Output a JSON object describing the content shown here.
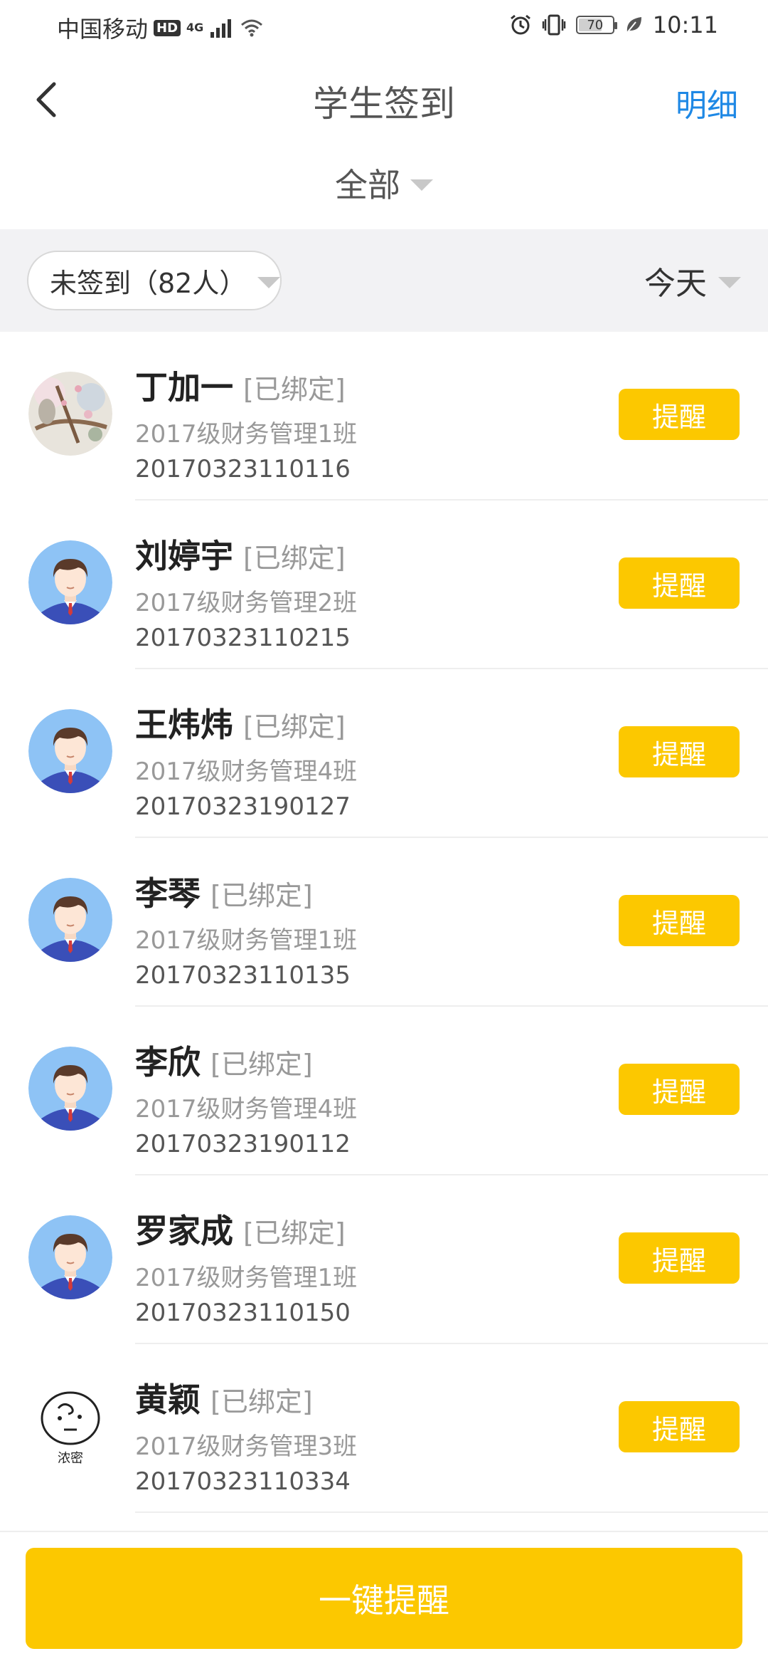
{
  "status_bar": {
    "carrier": "中国移动",
    "hd": "HD",
    "network": "4G",
    "battery": "70",
    "battery_fraction": 0.7,
    "time": "10:11"
  },
  "header": {
    "title": "学生签到",
    "detail": "明细"
  },
  "filter": {
    "scope": "全部",
    "status": "未签到（82人）",
    "date": "今天"
  },
  "students": [
    {
      "name": "丁加一",
      "bound": "[已绑定]",
      "class": "2017级财务管理1班",
      "id": "20170323110116",
      "avatar": "photo-avatar"
    },
    {
      "name": "刘婷宇",
      "bound": "[已绑定]",
      "class": "2017级财务管理2班",
      "id": "20170323110215",
      "avatar": "default-avatar"
    },
    {
      "name": "王炜炜",
      "bound": "[已绑定]",
      "class": "2017级财务管理4班",
      "id": "20170323190127",
      "avatar": "default-avatar"
    },
    {
      "name": "李琴",
      "bound": "[已绑定]",
      "class": "2017级财务管理1班",
      "id": "20170323110135",
      "avatar": "default-avatar"
    },
    {
      "name": "李欣",
      "bound": "[已绑定]",
      "class": "2017级财务管理4班",
      "id": "20170323190112",
      "avatar": "default-avatar"
    },
    {
      "name": "罗家成",
      "bound": "[已绑定]",
      "class": "2017级财务管理1班",
      "id": "20170323110150",
      "avatar": "default-avatar"
    },
    {
      "name": "黄颖",
      "bound": "[已绑定]",
      "class": "2017级财务管理3班",
      "id": "20170323110334",
      "avatar": "sketch-avatar",
      "avatar_caption": "浓密"
    }
  ],
  "remind_label": "提醒",
  "bottom": {
    "remind_all": "一键提醒"
  },
  "colors": {
    "accent_yellow": "#fcc800",
    "link_blue": "#1e88e5",
    "band_gray": "#f2f2f4"
  }
}
